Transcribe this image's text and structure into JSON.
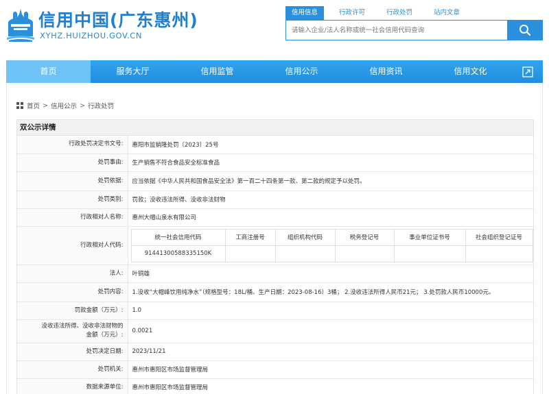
{
  "header": {
    "logo_title": "信用中国(广东惠州)",
    "logo_url": "XYHZ.HUIZHOU.GOV.CN",
    "search_tabs": [
      "信用信息",
      "行政许可",
      "行政处罚",
      "站内文章"
    ],
    "search_placeholder": "请输入企业/法人名称或统一社会信用代码查询"
  },
  "nav": {
    "items": [
      "首页",
      "服务大厅",
      "信用监管",
      "信用公示",
      "信用资讯",
      "信用文化"
    ]
  },
  "breadcrumb": [
    "首页",
    "信用公示",
    "行政处罚"
  ],
  "panel": {
    "title": "双公示详情",
    "rows": [
      {
        "label": "行政处罚决定书文号:",
        "value": "惠阳市监销隆处罚〔2023〕25号"
      },
      {
        "label": "处罚事由:",
        "value": "生产销售不符合食品安全标准食品"
      },
      {
        "label": "处罚依据:",
        "value": "应当依据《中华人民共和国食品安全法》第一百二十四条第一款、第二款的规定予以处罚。"
      },
      {
        "label": "处罚类别:",
        "value": "罚款；没收违法所得、没收非法财物"
      },
      {
        "label": "行政相对人名称:",
        "value": "惠州大帽山泉水有限公司"
      }
    ],
    "code_row": {
      "label": "行政相对人代码:",
      "headers": [
        "统一社会信用代码",
        "工商注册号",
        "组织机构代码",
        "税务登记号",
        "事业单位证书号",
        "社会组织登记证号"
      ],
      "values": [
        "91441300588335150K",
        "",
        "",
        "",
        "",
        ""
      ]
    },
    "rows2": [
      {
        "label": "法人:",
        "value": "叶铜雄"
      },
      {
        "label": "处罚内容:",
        "value": "1.没收“大帽峰饮用纯净水”（规格型号：18L/桶、生产日期：2023-08-16）3桶； 2.没收违法所得人民币21元； 3.处罚款人民币10000元。"
      },
      {
        "label": "罚款金额（万元）:",
        "value": "1.0"
      }
    ],
    "confiscation": {
      "label_line1": "没收违法所得、没收非法财物的",
      "label_line2": "金额（万元）:",
      "value": "0.0021"
    },
    "rows3": [
      {
        "label": "处罚决定日期:",
        "value": "2023/11/21"
      },
      {
        "label": "处罚机关:",
        "value": "惠州市惠阳区市场监督管理局"
      },
      {
        "label": "数据来源单位:",
        "value": "惠州市惠阳区市场监督管理局"
      }
    ]
  },
  "colors": {
    "brand_blue": "#1f7fd0",
    "nav_blue": "#2a98e6",
    "nav_active": "#6ec3f6"
  }
}
